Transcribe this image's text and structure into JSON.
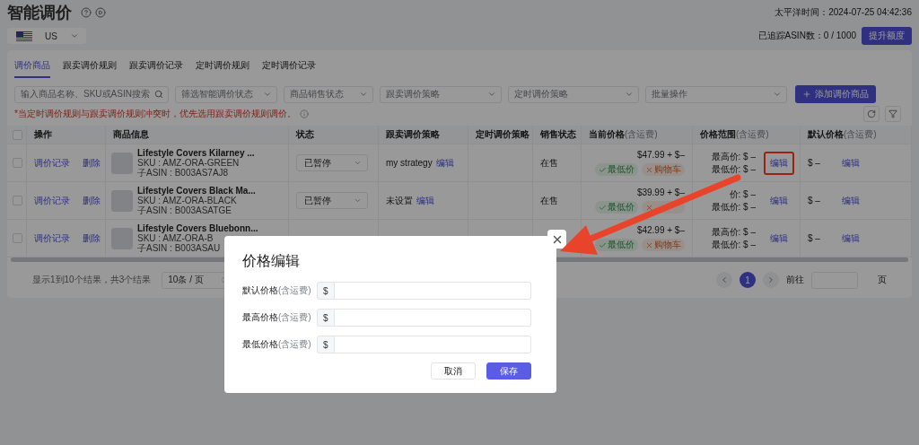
{
  "page": {
    "title": "智能调价",
    "time": "太平洋时间：2024-07-25 04:42:36",
    "region": "US",
    "tracked": "已追踪ASIN数：0 / 1000",
    "upgrade_button": "提升额度"
  },
  "tabs": [
    {
      "label": "调价商品",
      "selected": true
    },
    {
      "label": "跟卖调价规则",
      "selected": false
    },
    {
      "label": "跟卖调价记录",
      "selected": false
    },
    {
      "label": "定时调价规则",
      "selected": false
    },
    {
      "label": "定时调价记录",
      "selected": false
    }
  ],
  "filters": [
    {
      "kind": "search",
      "placeholder": "输入商品名称、SKU或ASIN搜索"
    },
    {
      "kind": "select",
      "placeholder": "筛选智能调价状态"
    },
    {
      "kind": "select",
      "placeholder": "商品销售状态"
    },
    {
      "kind": "select",
      "placeholder": "跟卖调价策略"
    },
    {
      "kind": "select",
      "placeholder": "定时调价策略"
    },
    {
      "kind": "select",
      "placeholder": "批量操作"
    }
  ],
  "add_button": "添加调价商品",
  "notice": "*当定时调价规则与跟卖调价规则冲突时，优先选用跟卖调价规则调价。",
  "table": {
    "select_all_checked": false,
    "columns": [
      {
        "label": "操作"
      },
      {
        "label": "商品信息"
      },
      {
        "label": "状态"
      },
      {
        "label": "跟卖调价策略"
      },
      {
        "label": "定时调价策略"
      },
      {
        "label": "销售状态"
      },
      {
        "label": "当前价格",
        "note": "(含运费)"
      },
      {
        "label": "价格范围",
        "note": "(含运费)"
      },
      {
        "label": "默认价格",
        "note": "(含运费)"
      }
    ],
    "rows": [
      {
        "checked": false,
        "actions": [
          "调价记录",
          "删除"
        ],
        "product": {
          "name": "Lifestyle Covers Kilarney ...",
          "sku": "SKU : AMZ-ORA-GREEN",
          "asin": "子ASIN : B003AS7AJ8"
        },
        "status": "已暂停",
        "strategy": {
          "text": "my strategy",
          "link": "编辑"
        },
        "sale": "在售",
        "price": "$47.99 + $–",
        "tags": [
          {
            "kind": "ok",
            "label": "最低价"
          },
          {
            "kind": "fail",
            "label": "购物车"
          }
        ],
        "range": {
          "high": "最高价: $ –",
          "low": "最低价: $ –",
          "link": "编辑",
          "highlighted": true
        },
        "default": {
          "value": "$ –",
          "link": "编辑"
        }
      },
      {
        "checked": false,
        "actions": [
          "调价记录",
          "删除"
        ],
        "product": {
          "name": "Lifestyle Covers Black Ma...",
          "sku": "SKU : AMZ-ORA-BLACK",
          "asin": "子ASIN : B003ASATGE"
        },
        "status": "已暂停",
        "strategy": {
          "text": "未设置",
          "link": "编辑"
        },
        "sale": "在售",
        "price": "$39.99 + $–",
        "tags": [
          {
            "kind": "ok",
            "label": "最低价"
          },
          {
            "kind": "fail"
          }
        ],
        "range": {
          "high": "价: $ –",
          "low": "最低价: $ –",
          "link": "编辑",
          "highlighted": false
        },
        "default": {
          "value": "$ –",
          "link": "编辑"
        }
      },
      {
        "checked": false,
        "actions": [
          "调价记录",
          "删除"
        ],
        "product": {
          "name": "Lifestyle Covers Bluebonn...",
          "sku": "SKU : AMZ-ORA-B",
          "asin": "子ASIN : B003ASAU"
        },
        "price": "$42.99 + $–",
        "tags": [
          {
            "kind": "ok",
            "label": "最低价"
          },
          {
            "kind": "fail",
            "label": "购物车"
          }
        ],
        "range": {
          "high": "最高价: $ –",
          "low": "最低价: $ –",
          "link": "编辑",
          "highlighted": false
        },
        "default": {
          "value": "$ –",
          "link": "编辑"
        }
      }
    ]
  },
  "footer": {
    "summary": "显示1到10个结果，共3个结果",
    "page_size": "10条 / 页",
    "pages": [
      {
        "label": "1",
        "selected": true
      }
    ],
    "goto": "前往",
    "goto_unit": "页"
  },
  "dialog": {
    "title": "价格编辑",
    "fields": [
      {
        "label": "默认价格",
        "note": "(含运费)",
        "prefix": "$"
      },
      {
        "label": "最高价格",
        "note": "(含运费)",
        "prefix": "$"
      },
      {
        "label": "最低价格",
        "note": "(含运费)",
        "prefix": "$"
      }
    ],
    "cancel": "取消",
    "save": "保存"
  }
}
